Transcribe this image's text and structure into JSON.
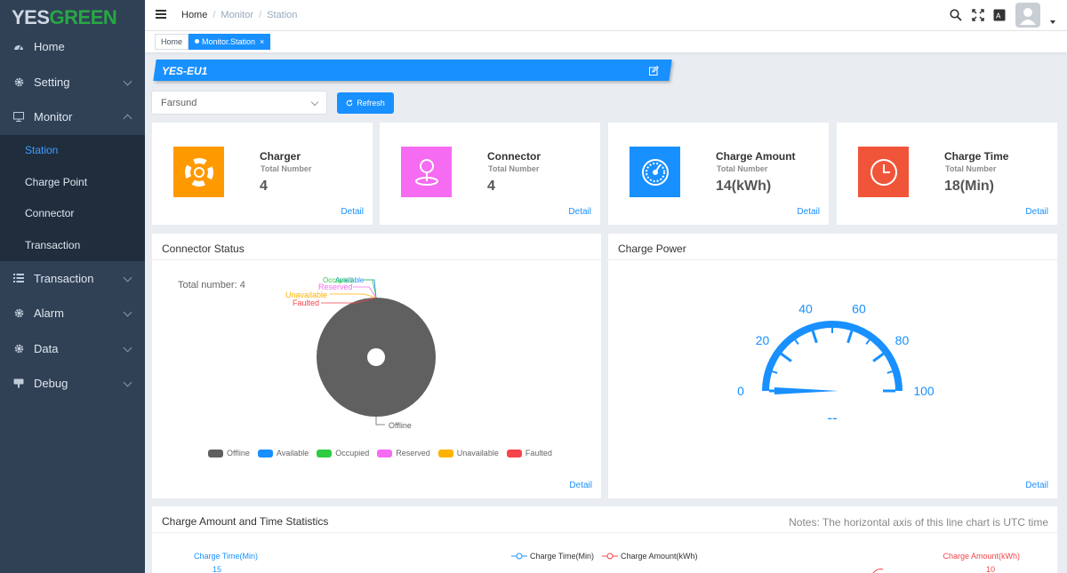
{
  "app": {
    "logo_part1": "YES",
    "logo_part2": "GREEN"
  },
  "sidebar": {
    "items": [
      {
        "label": "Home",
        "icon": "dashboard-icon"
      },
      {
        "label": "Setting",
        "icon": "gear-icon"
      },
      {
        "label": "Monitor",
        "icon": "monitor-icon"
      },
      {
        "label": "Transaction",
        "icon": "list-icon"
      },
      {
        "label": "Alarm",
        "icon": "gear-icon"
      },
      {
        "label": "Data",
        "icon": "gear-icon"
      },
      {
        "label": "Debug",
        "icon": "debug-icon"
      }
    ],
    "monitor_sub": [
      "Station",
      "Charge Point",
      "Connector",
      "Transaction"
    ]
  },
  "header": {
    "breadcrumb": [
      "Home",
      "Monitor",
      "Station"
    ]
  },
  "tags": {
    "home": "Home",
    "active": "Monitor.Station",
    "close": "×"
  },
  "station": {
    "name": "YES-EU1"
  },
  "filter": {
    "selected": "Farsund",
    "refresh_label": "Refresh"
  },
  "stats": [
    {
      "title": "Charger",
      "sub": "Total Number",
      "value": "4",
      "color": "#ff9900",
      "icon": "lifebuoy-icon"
    },
    {
      "title": "Connector",
      "sub": "Total Number",
      "value": "4",
      "color": "#f56cf2",
      "icon": "map-pin-icon"
    },
    {
      "title": "Charge Amount",
      "sub": "Total Number",
      "value": "14(kWh)",
      "color": "#1890ff",
      "icon": "gauge-icon"
    },
    {
      "title": "Charge Time",
      "sub": "Total Number",
      "value": "18(Min)",
      "color": "#f0553a",
      "icon": "clock-icon"
    }
  ],
  "detail_label": "Detail",
  "connector_status": {
    "title": "Connector Status",
    "total_text": "Total number: 4",
    "chart_data": {
      "type": "pie",
      "labels": [
        "Offline",
        "Available",
        "Occupied",
        "Reserved",
        "Unavailable",
        "Faulted"
      ],
      "values": [
        4,
        0,
        0,
        0,
        0,
        0
      ],
      "colors": [
        "#606060",
        "#1890ff",
        "#2ecc40",
        "#f56cf2",
        "#ffb300",
        "#f5444a"
      ],
      "legend_position": "bottom"
    }
  },
  "charge_power": {
    "title": "Charge Power",
    "chart_data": {
      "type": "gauge",
      "min": 0,
      "max": 100,
      "ticks": [
        "0",
        "20",
        "40",
        "60",
        "80",
        "100"
      ],
      "value": 0,
      "value_text": "--"
    }
  },
  "statistics": {
    "title": "Charge Amount and Time Statistics",
    "note": "Notes: The horizontal axis of this line chart is UTC time",
    "left_axis": "Charge Time(Min)",
    "right_axis": "Charge Amount(kWh)",
    "left_tick": "15",
    "right_tick": "10",
    "legend": [
      "Charge Time(Min)",
      "Charge Amount(kWh)"
    ]
  }
}
